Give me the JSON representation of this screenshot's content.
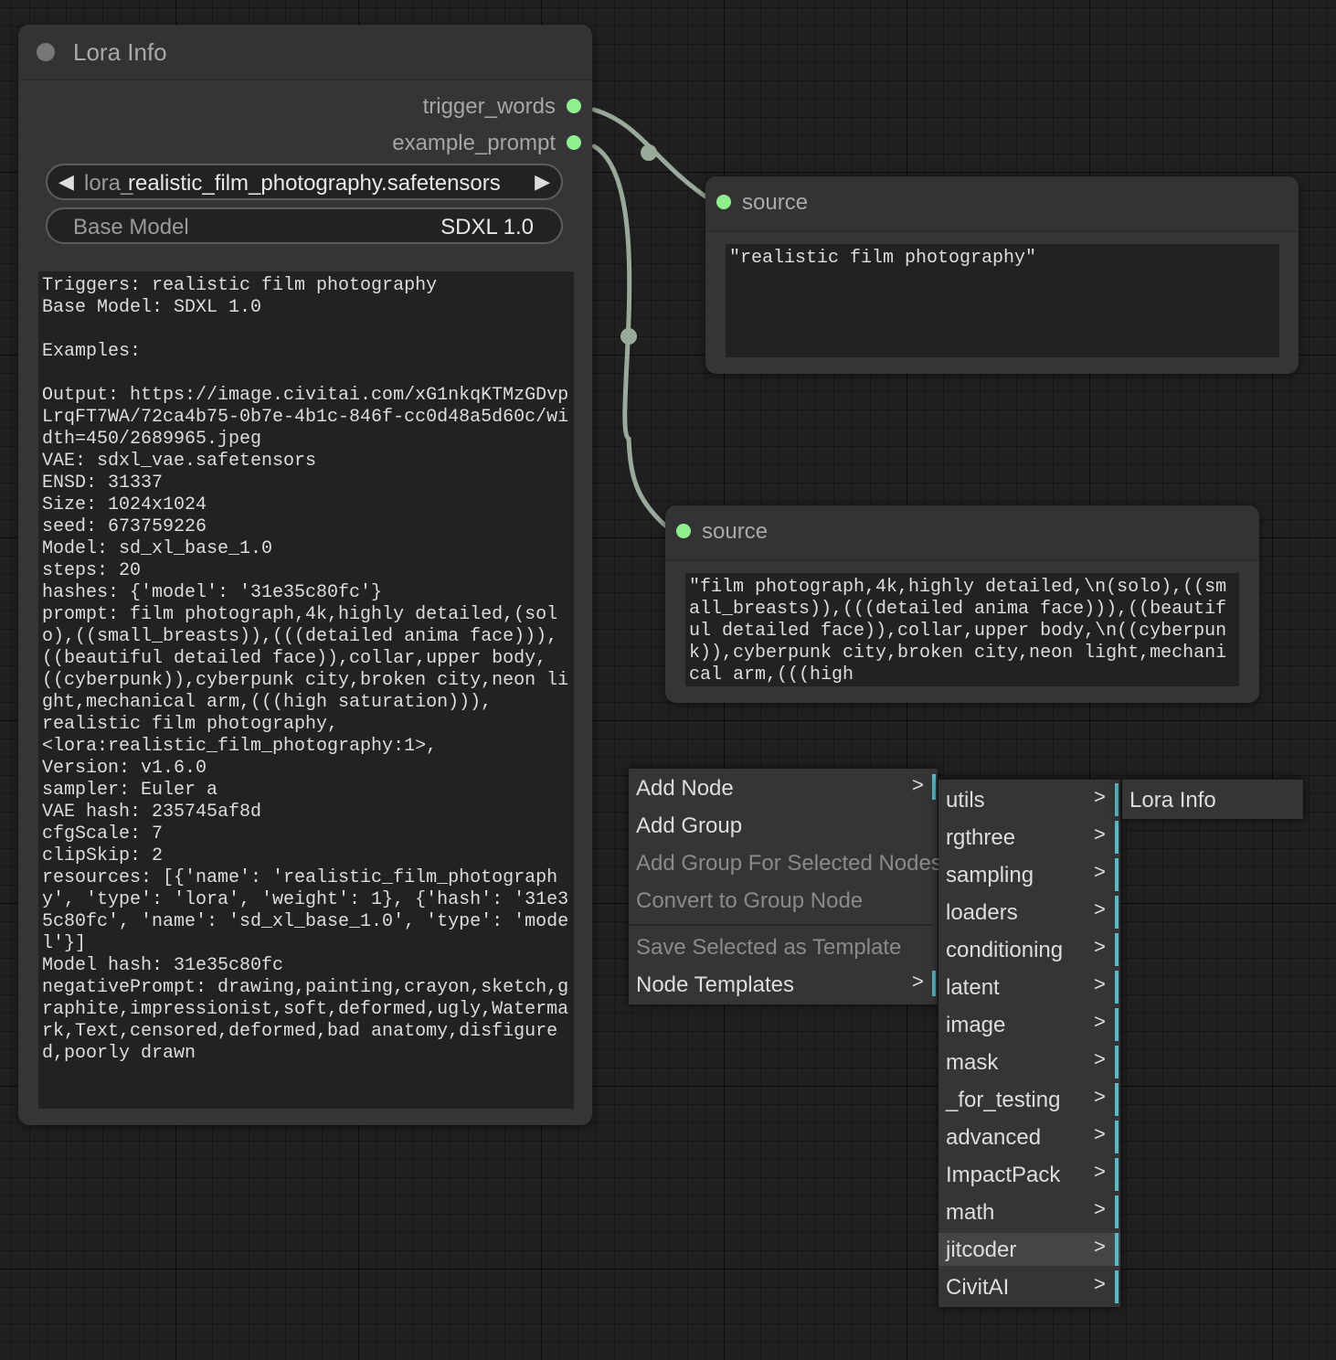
{
  "lora_node": {
    "title": "Lora Info",
    "outputs": [
      "trigger_words",
      "example_prompt"
    ],
    "lora_combo": {
      "ghost_label": "lora_",
      "value": "realistic_film_photography.safetensors",
      "left_arrow": "◀",
      "right_arrow": "▶"
    },
    "base_model": {
      "label": "Base Model",
      "value": "SDXL 1.0"
    },
    "info_text": "Triggers: realistic film photography\nBase Model: SDXL 1.0\n\nExamples:\n\nOutput: https://image.civitai.com/xG1nkqKTMzGDvpLrqFT7WA/72ca4b75-0b7e-4b1c-846f-cc0d48a5d60c/width=450/2689965.jpeg\nVAE: sdxl_vae.safetensors\nENSD: 31337\nSize: 1024x1024\nseed: 673759226\nModel: sd_xl_base_1.0\nsteps: 20\nhashes: {'model': '31e35c80fc'}\nprompt: film photograph,4k,highly detailed,(solo),((small_breasts)),(((detailed anima face))),((beautiful detailed face)),collar,upper body,\n((cyberpunk)),cyberpunk city,broken city,neon light,mechanical arm,(((high saturation))),\nrealistic film photography,\n<lora:realistic_film_photography:1>,\nVersion: v1.6.0\nsampler: Euler a\nVAE hash: 235745af8d\ncfgScale: 7\nclipSkip: 2\nresources: [{'name': 'realistic_film_photography', 'type': 'lora', 'weight': 1}, {'hash': '31e35c80fc', 'name': 'sd_xl_base_1.0', 'type': 'model'}]\nModel hash: 31e35c80fc\nnegativePrompt: drawing,painting,crayon,sketch,graphite,impressionist,soft,deformed,ugly,Watermark,Text,censored,deformed,bad anatomy,disfigured,poorly drawn"
  },
  "source_node_1": {
    "title": "source",
    "text": "\"realistic film photography\""
  },
  "source_node_2": {
    "title": "source",
    "text": "\"film photograph,4k,highly detailed,\\n(solo),((small_breasts)),(((detailed anima face))),((beautiful detailed face)),collar,upper body,\\n((cyberpunk)),cyberpunk city,broken city,neon light,mechanical arm,(((high"
  },
  "context_menu": {
    "items": [
      {
        "label": "Add Node",
        "submenu": ">"
      },
      {
        "label": "Add Group"
      },
      {
        "label": "Add Group For Selected Nodes"
      },
      {
        "label": "Convert to Group Node"
      },
      {
        "label": "Save Selected as Template"
      },
      {
        "label": "Node Templates",
        "submenu": ">"
      }
    ]
  },
  "submenu": {
    "items": [
      "utils",
      "rgthree",
      "sampling",
      "loaders",
      "conditioning",
      "latent",
      "image",
      "mask",
      "_for_testing",
      "advanced",
      "ImpactPack",
      "math",
      "jitcoder",
      "CivitAI"
    ],
    "arrow": ">"
  },
  "submenu_2": {
    "items": [
      "Lora Info"
    ]
  },
  "colors": {
    "slot_connected": "#8ff08f",
    "link": "#9aaa9a",
    "menu_accent": "#56bbc6",
    "canvas_bg": "#202020",
    "node_bg": "#353535"
  }
}
